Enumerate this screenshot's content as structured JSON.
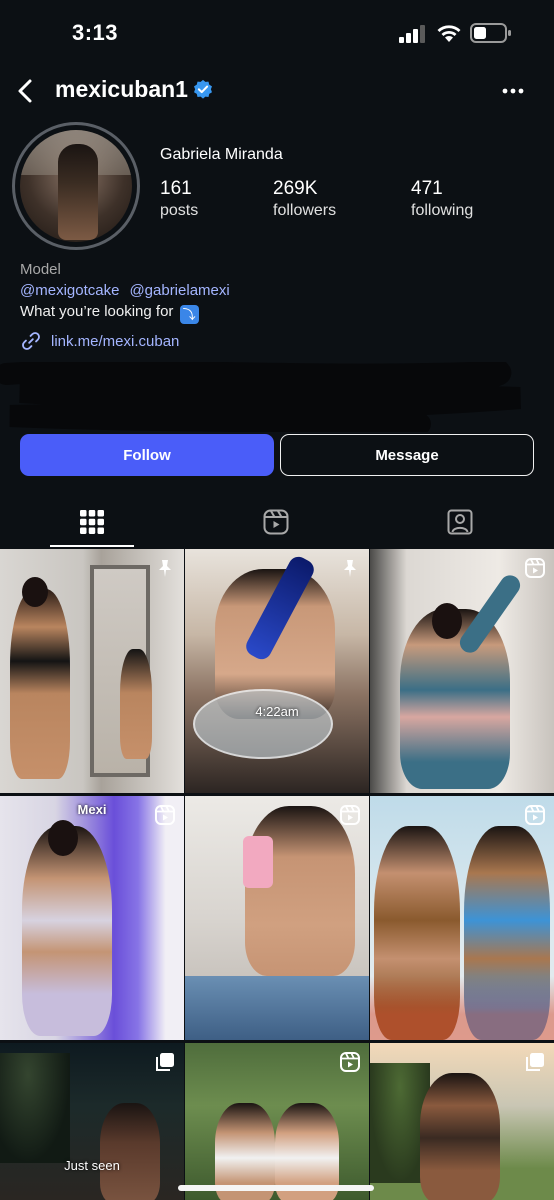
{
  "status_bar": {
    "time": "3:13"
  },
  "nav": {
    "username": "mexicuban1"
  },
  "profile": {
    "full_name": "Gabriela Miranda",
    "stats": [
      {
        "value": "161",
        "label": "posts"
      },
      {
        "value": "269K",
        "label": "followers"
      },
      {
        "value": "471",
        "label": "following"
      }
    ],
    "category": "Model",
    "mentions": [
      "@mexigotcake",
      "@gabrielamexi"
    ],
    "bio_text": "What you’re looking for",
    "bio_emoji": "⤵",
    "link": "link.me/mexi.cuban"
  },
  "buttons": {
    "follow": "Follow",
    "message": "Message"
  },
  "tabs": [
    "grid",
    "reels",
    "tagged"
  ],
  "grid": {
    "cells": [
      {
        "kind": "photo",
        "icon": "pin-icon",
        "caption": ""
      },
      {
        "kind": "photo",
        "icon": "pin-icon",
        "caption": "4:22am"
      },
      {
        "kind": "reel",
        "icon": "reel-icon",
        "caption": ""
      },
      {
        "kind": "reel",
        "icon": "reel-icon",
        "caption": "Mexi"
      },
      {
        "kind": "reel",
        "icon": "reel-icon",
        "caption": ""
      },
      {
        "kind": "reel",
        "icon": "reel-icon",
        "caption": ""
      },
      {
        "kind": "carousel",
        "icon": "carousel-icon",
        "caption": "Just seen"
      },
      {
        "kind": "reel",
        "icon": "reel-icon",
        "caption": ""
      },
      {
        "kind": "carousel",
        "icon": "carousel-icon",
        "caption": ""
      }
    ]
  },
  "colors": {
    "background": "#0c1014",
    "accent": "#4a5df9",
    "link": "#a4b5ff",
    "verified": "#3897f0"
  }
}
